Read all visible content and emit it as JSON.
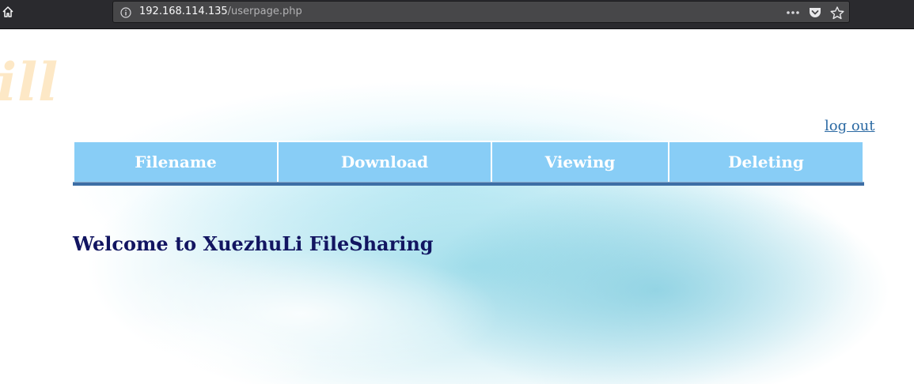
{
  "browser": {
    "url_host": "192.168.114.135",
    "url_path": "/userpage.php",
    "home_icon": "home-icon",
    "info_icon": "info-icon",
    "actions": [
      "more-icon",
      "pocket-icon",
      "star-icon"
    ]
  },
  "header": {
    "logo_fragment": "ill",
    "logout_label": "log out"
  },
  "menu": {
    "columns": [
      "Filename",
      "Download",
      "Viewing",
      "Deleting"
    ]
  },
  "main": {
    "welcome": "Welcome to XuezhuLi FileSharing"
  },
  "colors": {
    "menu_bg": "#88cdf6",
    "menu_rule": "#3d6ea5",
    "welcome_text": "#121561",
    "logout_link": "#2c6aa3",
    "logo_fragment": "#fde8c6"
  }
}
